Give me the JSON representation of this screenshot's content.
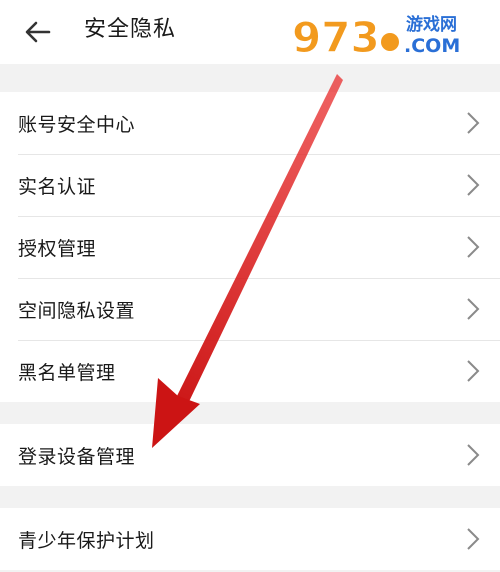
{
  "header": {
    "title": "安全隐私",
    "back_icon": "arrow-left-icon"
  },
  "watermark": {
    "digits": "973",
    "site": "游戏网",
    "domain": ".COM"
  },
  "groups": [
    {
      "items": [
        {
          "label": "账号安全中心",
          "icon": "chevron-right-icon"
        },
        {
          "label": "实名认证",
          "icon": "chevron-right-icon"
        },
        {
          "label": "授权管理",
          "icon": "chevron-right-icon"
        },
        {
          "label": "空间隐私设置",
          "icon": "chevron-right-icon"
        },
        {
          "label": "黑名单管理",
          "icon": "chevron-right-icon"
        }
      ]
    },
    {
      "items": [
        {
          "label": "登录设备管理",
          "icon": "chevron-right-icon"
        }
      ]
    },
    {
      "items": [
        {
          "label": "青少年保护计划",
          "icon": "chevron-right-icon"
        }
      ]
    }
  ],
  "colors": {
    "annotation_arrow": "#d81818",
    "background": "#f2f2f2",
    "watermark_orange": "#f29a1e",
    "watermark_blue": "#2a6fd6"
  }
}
